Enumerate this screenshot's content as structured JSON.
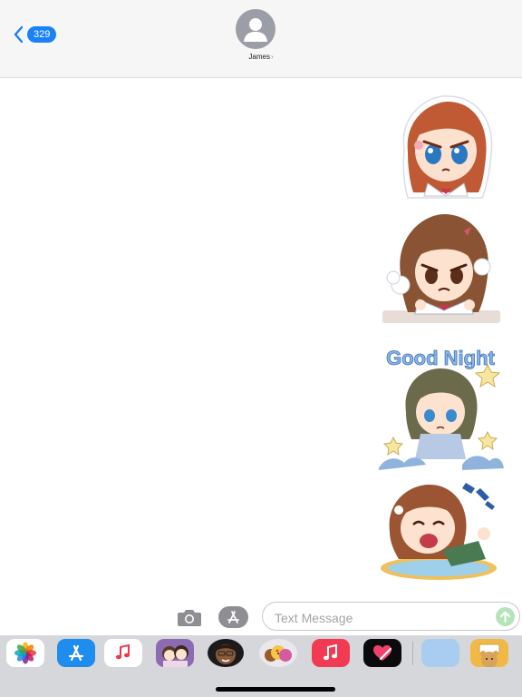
{
  "header": {
    "back_count": "329",
    "contact_name": "James",
    "contact_chevron": "›"
  },
  "messages": [
    {
      "type": "sticker",
      "description_icon": "angry-girl-sticker-icon"
    },
    {
      "type": "sticker",
      "description_icon": "fuming-girl-sticker-icon"
    },
    {
      "type": "sticker",
      "text": "Good Night",
      "description_icon": "good-night-girl-sticker-icon"
    },
    {
      "type": "sticker",
      "description_icon": "laughing-girl-sticker-icon"
    }
  ],
  "composer": {
    "placeholder": "Text Message",
    "value": ""
  },
  "apps": [
    {
      "name": "photos-icon"
    },
    {
      "name": "app-store-icon"
    },
    {
      "name": "music-icon"
    },
    {
      "name": "couple-sticker-app-icon"
    },
    {
      "name": "memoji-icon"
    },
    {
      "name": "animoji-icon"
    },
    {
      "name": "music-app-icon"
    },
    {
      "name": "digital-touch-icon"
    },
    {
      "name": "blank-app-icon"
    },
    {
      "name": "bear-sticker-app-icon"
    }
  ],
  "colors": {
    "accent": "#1a82f7",
    "header_bg": "#f6f6f7",
    "drawer_bg": "#d6d7db",
    "send_disabled": "#b5e4ba"
  }
}
